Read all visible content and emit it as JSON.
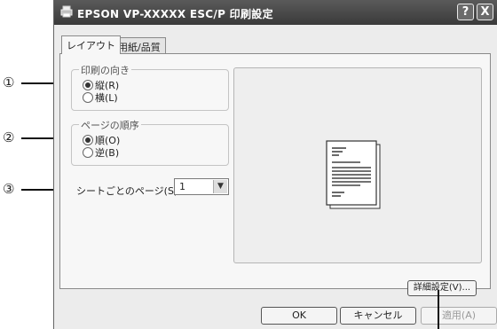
{
  "window": {
    "title": "EPSON VP-XXXXX ESC/P 印刷設定",
    "help": "?",
    "close": "X"
  },
  "tabs": [
    {
      "label": "レイアウト"
    },
    {
      "label": "用紙/品質"
    }
  ],
  "orientation": {
    "title": "印刷の向き",
    "options": [
      {
        "label": "縦(R)",
        "selected": true
      },
      {
        "label": "横(L)",
        "selected": false
      }
    ]
  },
  "page_order": {
    "title": "ページの順序",
    "options": [
      {
        "label": "順(O)",
        "selected": true
      },
      {
        "label": "逆(B)",
        "selected": false
      }
    ]
  },
  "pages_per_sheet": {
    "label": "シートごとのページ(S):",
    "value": "1"
  },
  "buttons": {
    "advanced": "詳細設定(V)...",
    "ok": "OK",
    "cancel": "キャンセル",
    "apply": "適用(A)"
  },
  "callouts": [
    "①",
    "②",
    "③"
  ]
}
